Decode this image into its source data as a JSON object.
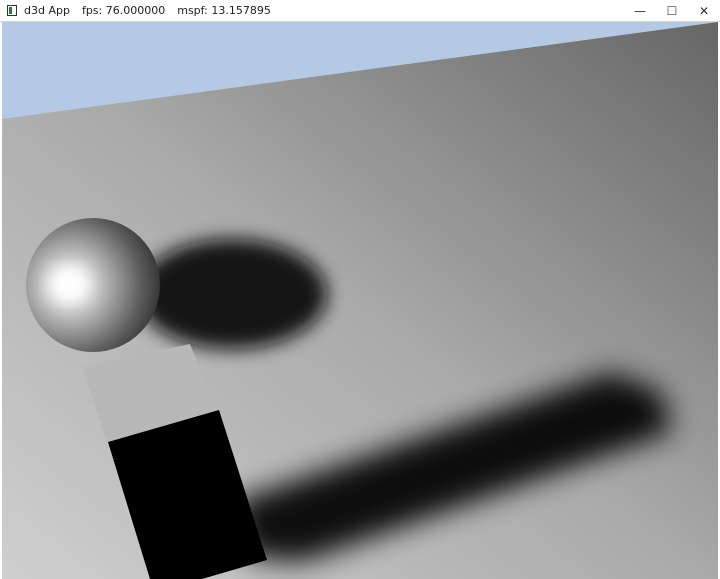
{
  "window": {
    "app_title": "d3d App",
    "fps_text": "fps: 76.000000",
    "mspf_text": "mspf: 13.157895",
    "minimize_glyph": "—",
    "maximize_glyph": "☐",
    "close_glyph": "✕"
  },
  "scene": {
    "sky_color": "#b6c9e4",
    "floor_light": "#c3c3c3",
    "floor_dark": "#6a6a6a",
    "box_top_color": "#b8b8b8",
    "box_side_color": "#000000",
    "sphere_highlight": "#ffffff",
    "sphere_shadow_color": "#303030"
  }
}
